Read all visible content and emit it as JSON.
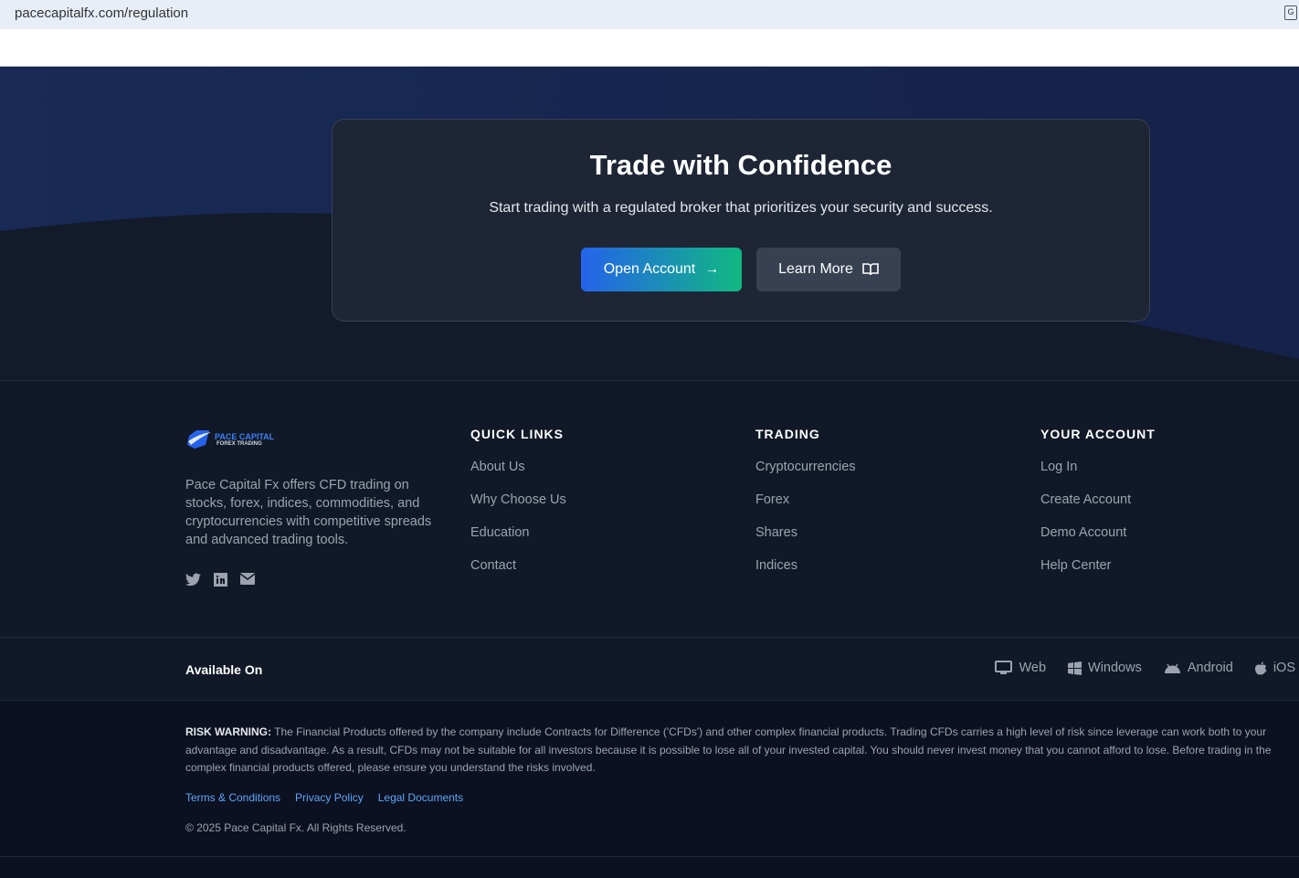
{
  "browser": {
    "url": "pacecapitalfx.com/regulation"
  },
  "cta": {
    "title": "Trade with Confidence",
    "subtitle": "Start trading with a regulated broker that prioritizes your security and success.",
    "open_account": "Open Account",
    "learn_more": "Learn More"
  },
  "footer": {
    "logo": {
      "line1": "PACE CAPITAL",
      "line2": "FOREX TRADING"
    },
    "about": "Pace Capital Fx offers CFD trading on stocks, forex, indices, commodities, and cryptocurrencies with competitive spreads and advanced trading tools.",
    "columns": [
      {
        "title": "QUICK LINKS",
        "links": [
          "About Us",
          "Why Choose Us",
          "Education",
          "Contact"
        ]
      },
      {
        "title": "TRADING",
        "links": [
          "Cryptocurrencies",
          "Forex",
          "Shares",
          "Indices"
        ]
      },
      {
        "title": "YOUR ACCOUNT",
        "links": [
          "Log In",
          "Create Account",
          "Demo Account",
          "Help Center"
        ]
      }
    ]
  },
  "available": {
    "label": "Available On",
    "platforms": [
      "Web",
      "Windows",
      "Android",
      "iOS"
    ]
  },
  "legal": {
    "risk_label": "RISK WARNING:",
    "risk_text": " The Financial Products offered by the company include Contracts for Difference ('CFDs') and other complex financial products. Trading CFDs carries a high level of risk since leverage can work both to your advantage and disadvantage. As a result, CFDs may not be suitable for all investors because it is possible to lose all of your invested capital. You should never invest money that you cannot afford to lose. Before trading in the complex financial products offered, please ensure you understand the risks involved.",
    "links": [
      "Terms & Conditions",
      "Privacy Policy",
      "Legal Documents"
    ],
    "copyright": "© 2025 Pace Capital Fx. All Rights Reserved."
  }
}
